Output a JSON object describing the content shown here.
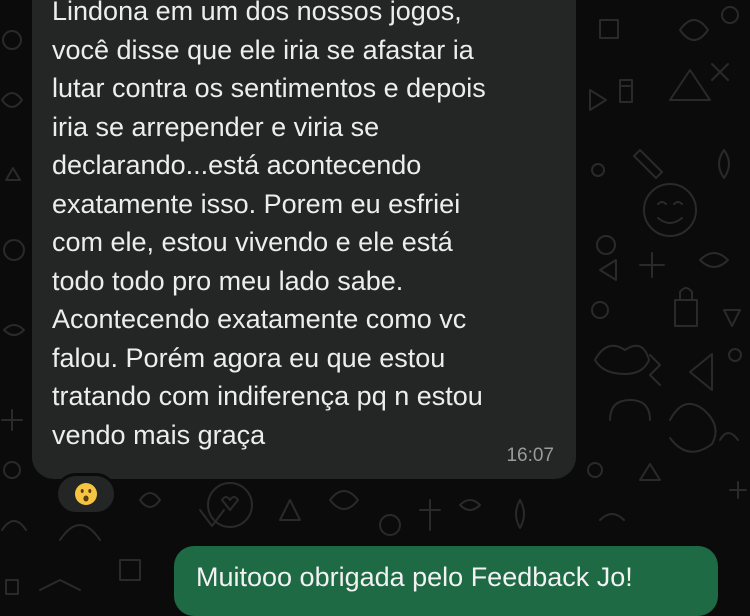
{
  "theme": {
    "background": "#0b0b0b",
    "incoming_bubble": "#242626",
    "outgoing_bubble": "#1d6a45",
    "text": "#ededed",
    "timestamp": "#9a9a9a"
  },
  "chat": {
    "incoming_message": {
      "text": "Lindona em um dos nossos jogos,\nvocê disse que ele iria se afastar ia\nlutar contra os sentimentos e depois\niria se arrepender e viria se\ndeclarando...está acontecendo\nexatamente isso. Porem eu esfriei\ncom ele, estou vivendo e ele está\ntodo todo pro meu lado sabe.\nAcontecendo exatamente como vc\nfalou. Porém agora eu que estou\ntratando com indiferença pq n estou\nvendo mais graça",
      "time": "16:07",
      "reaction": "surprised-face-emoji"
    },
    "outgoing_message": {
      "text": "Muitooo obrigada pelo Feedback Jo!"
    }
  }
}
